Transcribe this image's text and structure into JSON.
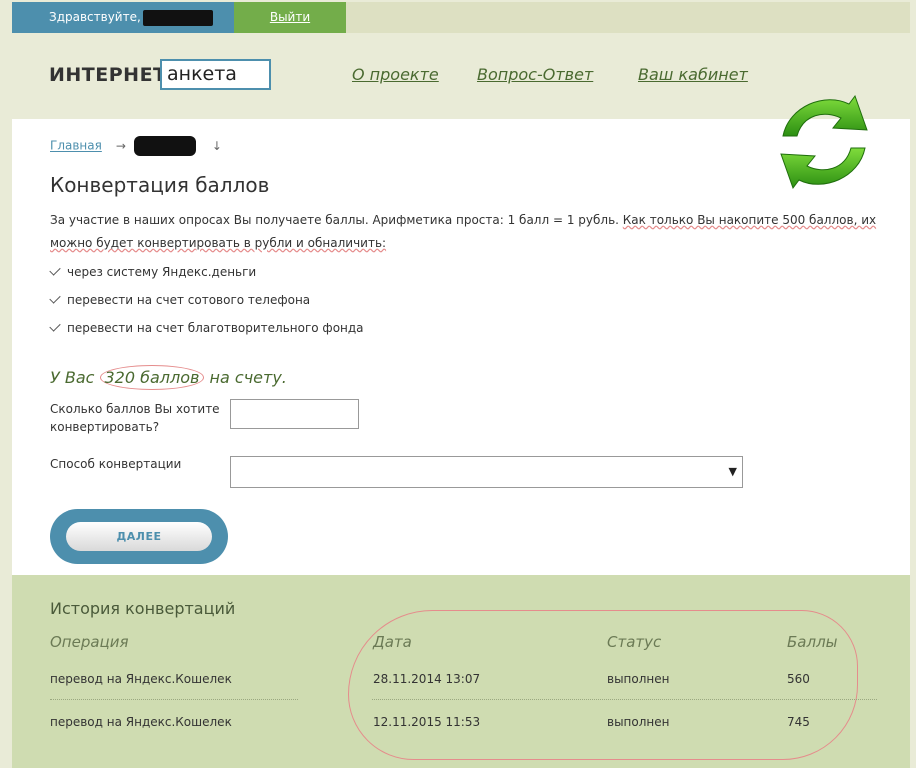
{
  "topbar": {
    "greeting": "Здравствуйте,",
    "logout": "Выйти"
  },
  "header": {
    "logo_word": "ИНТЕРНЕТ",
    "logo_box": "анкета",
    "nav": [
      "О проекте",
      "Вопрос-Ответ",
      "Ваш кабинет"
    ]
  },
  "icons": {
    "refresh": "refresh-arrows-icon"
  },
  "breadcrumb": {
    "home": "Главная",
    "arrow": "→",
    "down": "↓"
  },
  "page": {
    "title": "Конвертация баллов",
    "intro_plain": "За участие в наших опросах Вы получаете баллы. Арифметика проста: 1 балл = 1 рубль. ",
    "intro_marked": "Как только Вы накопите 500 баллов, их можно будет конвертировать в рубли и обналичить:",
    "options": [
      "через систему Яндекс.деньги",
      "перевести на счет сотового телефона",
      "перевести на счет благотворительного фонда"
    ],
    "balance_prefix": "У Вас ",
    "balance_value": "320 баллов",
    "balance_suffix": " на счету."
  },
  "form": {
    "amount_label": "Сколько баллов Вы хотите конвертировать?",
    "amount_value": "",
    "method_label": "Способ конвертации",
    "method_value": "",
    "caret": "▼",
    "submit": "ДАЛЕЕ"
  },
  "history": {
    "title": "История конвертаций",
    "columns": [
      "Операция",
      "Дата",
      "Статус",
      "Баллы"
    ],
    "rows": [
      {
        "operation": "перевод на Яндекс.Кошелек",
        "date": "28.11.2014 13:07",
        "status": "выполнен",
        "points": "560"
      },
      {
        "operation": "перевод на Яндекс.Кошелек",
        "date": "12.11.2015 11:53",
        "status": "выполнен",
        "points": "745"
      }
    ]
  },
  "colors": {
    "blue": "#4d8fad",
    "green": "#73ad4a",
    "olive": "#4a6a30",
    "history_bg": "#cfdcb1",
    "annotation": "#e58c8c"
  }
}
